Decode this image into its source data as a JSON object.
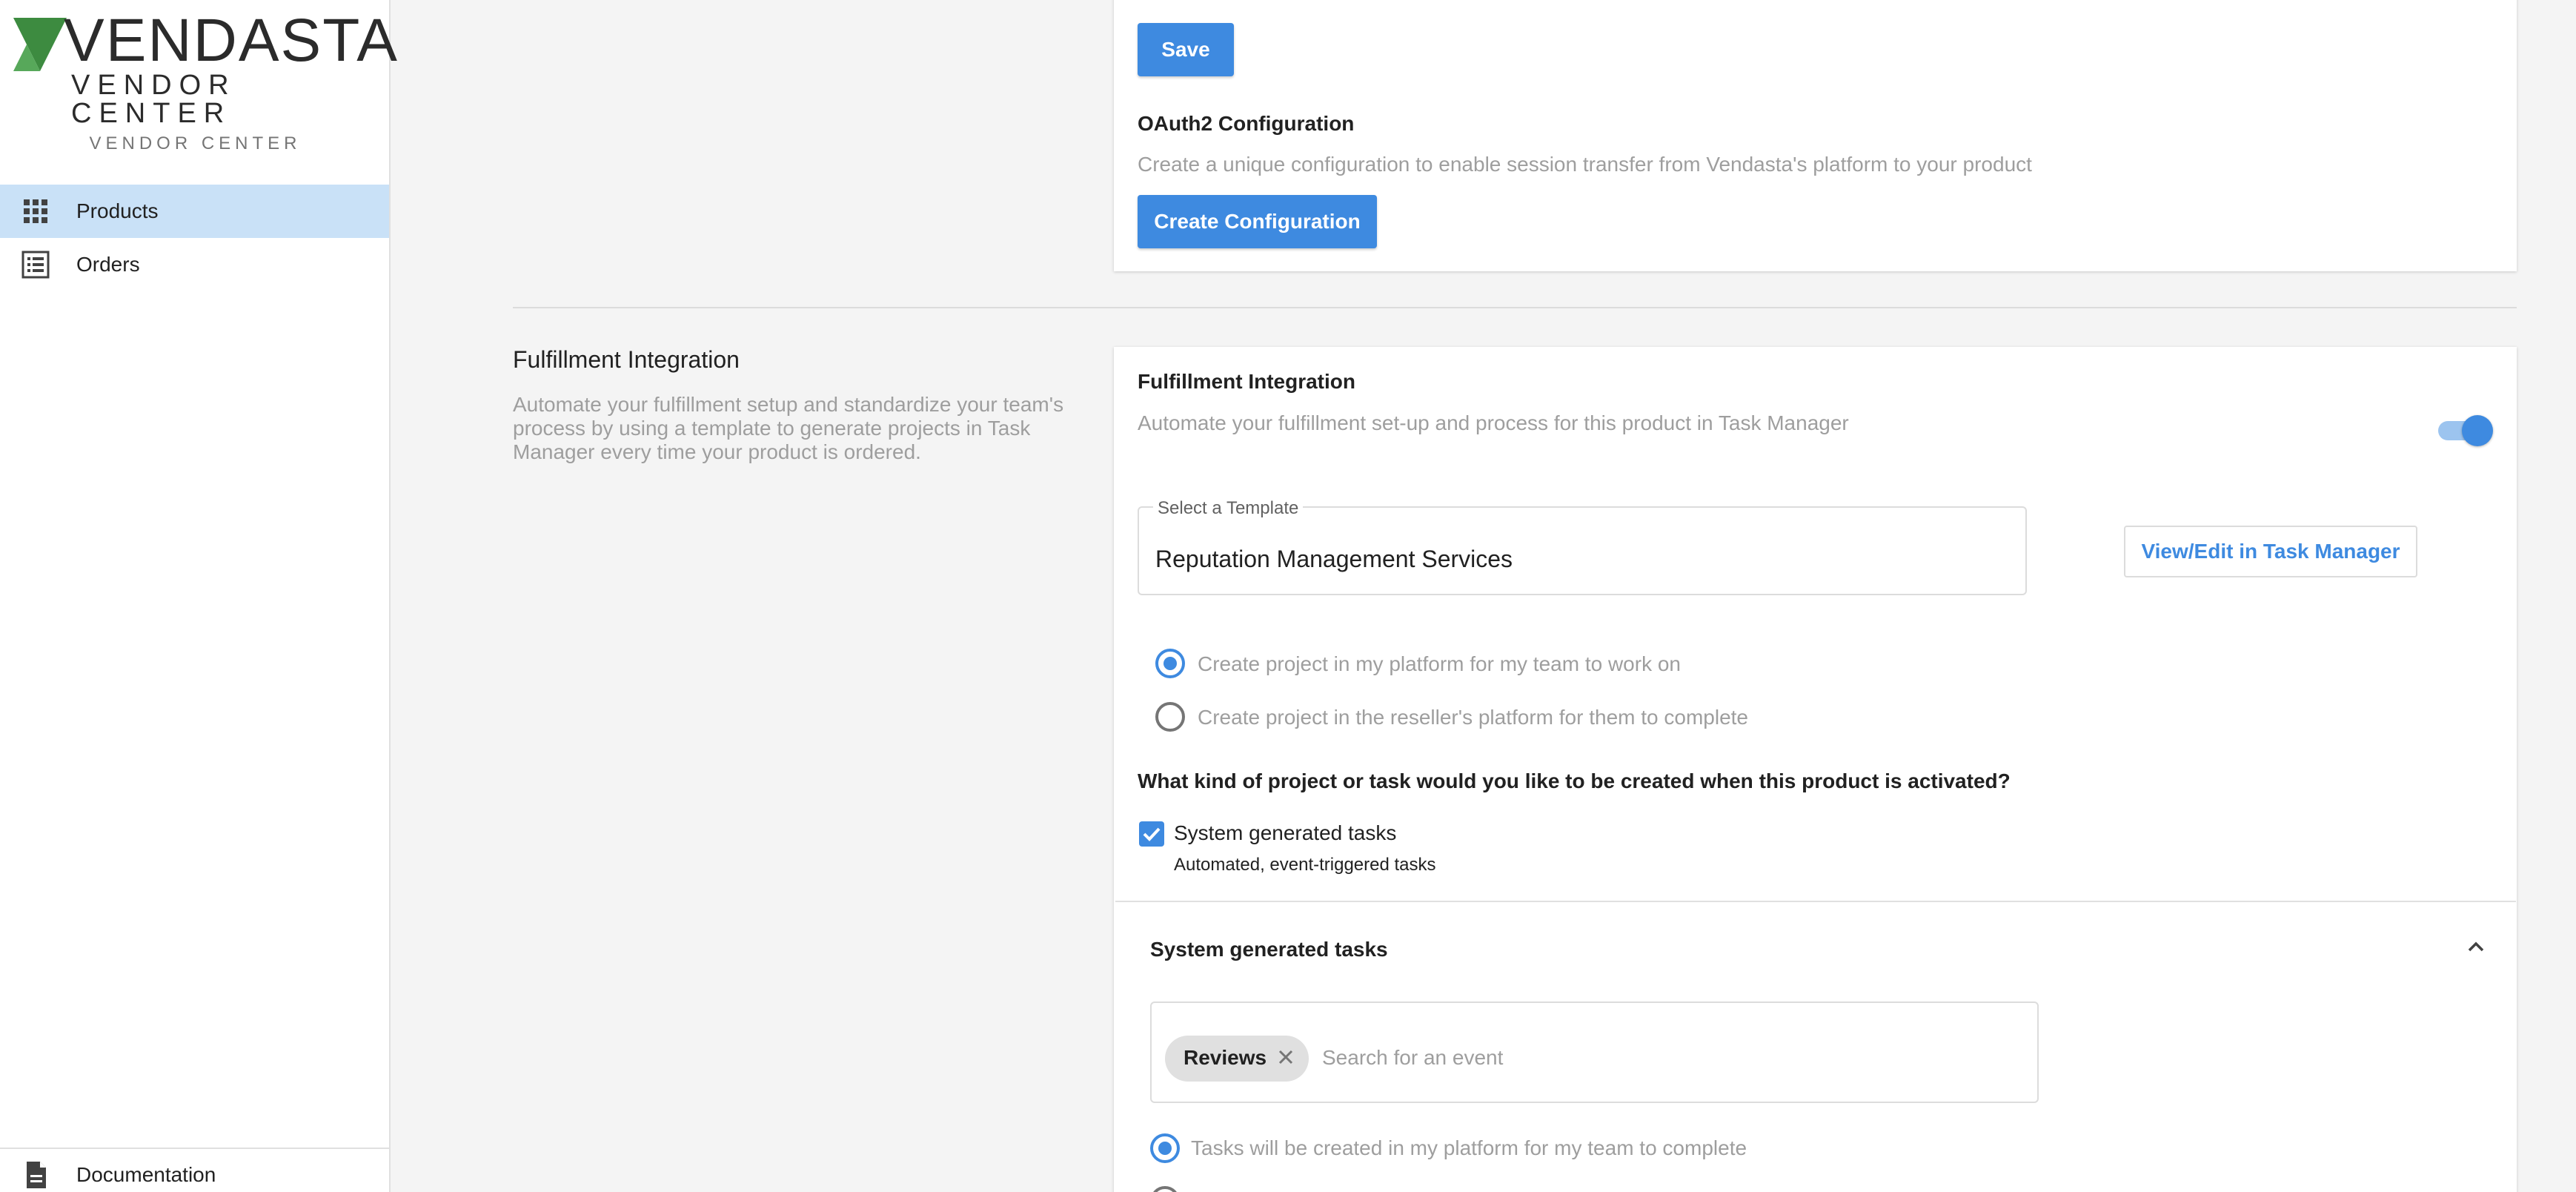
{
  "sidebar": {
    "logo_text": "VENDASTA",
    "logo_subtext": "VENDOR CENTER",
    "caption": "VENDOR CENTER",
    "items": [
      {
        "label": "Products",
        "icon": "grid-icon",
        "active": true
      },
      {
        "label": "Orders",
        "icon": "list-icon",
        "active": false
      }
    ],
    "footer_item": {
      "label": "Documentation",
      "icon": "document-icon"
    }
  },
  "top_card": {
    "save_label": "Save",
    "oauth_title": "OAuth2 Configuration",
    "oauth_desc": "Create a unique configuration to enable session transfer from Vendasta's platform to your product",
    "create_config_label": "Create Configuration"
  },
  "fulfillment_section": {
    "title": "Fulfillment Integration",
    "description": "Automate your fulfillment setup and standardize your team's process by using a template to generate projects in Task Manager every time your product is ordered."
  },
  "fulfillment_card": {
    "title": "Fulfillment Integration",
    "description": "Automate your fulfillment set-up and process for this product in Task Manager",
    "toggle_on": true,
    "template_label": "Select a Template",
    "template_value": "Reputation Management Services",
    "view_edit_label": "View/Edit in Task Manager",
    "project_options": [
      {
        "label": "Create project in my platform for my team to work on",
        "checked": true
      },
      {
        "label": "Create project in the reseller's platform for them to complete",
        "checked": false
      }
    ],
    "question": "What kind of project or task would you like to be created when this product is activated?",
    "system_tasks_checkbox": {
      "label": "System generated tasks",
      "sublabel": "Automated, event-triggered tasks",
      "checked": true
    },
    "system_tasks_panel": {
      "title": "System generated tasks",
      "chip_label": "Reviews",
      "search_placeholder": "Search for an event",
      "task_option": "Tasks will be created in my platform for my team to complete"
    }
  },
  "colors": {
    "accent": "#3e8ae0",
    "active_nav": "#c9e1f7",
    "logo_green": "#3d8b40"
  }
}
